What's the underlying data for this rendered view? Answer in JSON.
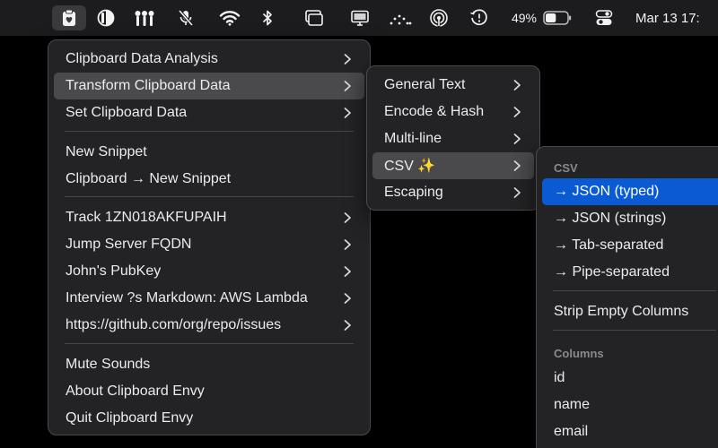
{
  "menubar": {
    "icons": [
      "clipboard-icon",
      "contrast-icon",
      "equalizer-icon",
      "microphone-muted-icon",
      "wifi-icon",
      "bluetooth-icon",
      "window-switcher-icon",
      "display-icon",
      "dots-activity-icon",
      "airdrop-icon",
      "time-machine-icon",
      "battery-icon",
      "control-center-icon"
    ],
    "battery_percent": "49%",
    "battery_level": 0.49,
    "clock": "Mar 13  17:"
  },
  "main_menu": {
    "items": [
      {
        "label": "Clipboard Data Analysis",
        "submenu": true
      },
      {
        "label": "Transform Clipboard Data",
        "submenu": true,
        "highlighted": true
      },
      {
        "label": "Set Clipboard Data",
        "submenu": true
      },
      {
        "label": "New Snippet",
        "submenu": false
      },
      {
        "label": "Clipboard → New Snippet",
        "submenu": false
      },
      {
        "label": "Track 1ZN018AKFUPAIH",
        "submenu": true
      },
      {
        "label": "Jump Server FQDN",
        "submenu": true
      },
      {
        "label": "John's PubKey",
        "submenu": true
      },
      {
        "label": "Interview ?s Markdown: AWS Lambda",
        "submenu": true
      },
      {
        "label": "https://github.com/org/repo/issues",
        "submenu": true
      },
      {
        "label": "Mute Sounds",
        "submenu": false
      },
      {
        "label": "About Clipboard Envy",
        "submenu": false
      },
      {
        "label": "Quit Clipboard Envy",
        "submenu": false
      }
    ]
  },
  "transform_menu": {
    "items": [
      {
        "label": "General Text",
        "submenu": true
      },
      {
        "label": "Encode & Hash",
        "submenu": true
      },
      {
        "label": "Multi-line",
        "submenu": true
      },
      {
        "label": "CSV ✨",
        "submenu": true,
        "highlighted": true
      },
      {
        "label": "Escaping",
        "submenu": true
      }
    ]
  },
  "csv_menu": {
    "header_csv": "CSV",
    "items": [
      {
        "label": "→ JSON (typed)",
        "selected": true
      },
      {
        "label": "→ JSON (strings)"
      },
      {
        "label": "→ Tab-separated"
      },
      {
        "label": "→ Pipe-separated"
      },
      {
        "label": "Strip Empty Columns"
      }
    ],
    "header_columns": "Columns",
    "columns": [
      {
        "label": "id"
      },
      {
        "label": "name"
      },
      {
        "label": "email"
      }
    ]
  }
}
